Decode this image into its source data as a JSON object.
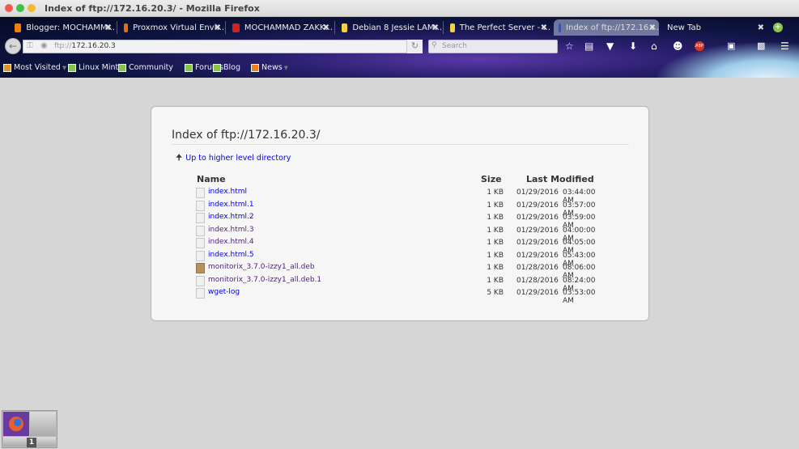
{
  "window": {
    "title": "Index of ftp://172.16.20.3/ - Mozilla Firefox"
  },
  "tabs": [
    {
      "label": "Blogger: MOCHAMM...",
      "icon": "blogger-icon",
      "color": "#f57d00"
    },
    {
      "label": "Proxmox Virtual Envi...",
      "icon": "proxmox-icon",
      "color": "#e57000"
    },
    {
      "label": "MOCHAMMAD ZAKK...",
      "icon": "zotero-icon",
      "color": "#cc2222"
    },
    {
      "label": "Debian 8 Jessie LAM...",
      "icon": "lightbulb-icon",
      "color": "#f5d142"
    },
    {
      "label": "The Perfect Server - ...",
      "icon": "lightbulb-icon",
      "color": "#f5d142"
    },
    {
      "label": "Index of ftp://172.16....",
      "icon": "monitor-icon",
      "color": "#3355aa"
    },
    {
      "label": "New Tab",
      "icon": "",
      "color": ""
    }
  ],
  "nav": {
    "url_prefix": "ftp://",
    "url_host": "172.16.20.3",
    "search_placeholder": "Search"
  },
  "bookmarks": [
    "Most Visited",
    "Linux Mint",
    "Community",
    "Forums",
    "Blog",
    "News"
  ],
  "page": {
    "heading": "Index of ftp://172.16.20.3/",
    "up_link": "Up to higher level directory",
    "columns": {
      "name": "Name",
      "size": "Size",
      "modified": "Last Modified"
    },
    "files": [
      {
        "name": "index.html",
        "size": "1 KB",
        "date": "01/29/2016",
        "time": "03:44:00 AM",
        "visited": false,
        "type": "html"
      },
      {
        "name": "index.html.1",
        "size": "1 KB",
        "date": "01/29/2016",
        "time": "03:57:00 AM",
        "visited": false,
        "type": "file"
      },
      {
        "name": "index.html.2",
        "size": "1 KB",
        "date": "01/29/2016",
        "time": "03:59:00 AM",
        "visited": false,
        "type": "file"
      },
      {
        "name": "index.html.3",
        "size": "1 KB",
        "date": "01/29/2016",
        "time": "04:00:00 AM",
        "visited": true,
        "type": "file"
      },
      {
        "name": "index.html.4",
        "size": "1 KB",
        "date": "01/29/2016",
        "time": "04:05:00 AM",
        "visited": true,
        "type": "file"
      },
      {
        "name": "index.html.5",
        "size": "1 KB",
        "date": "01/29/2016",
        "time": "05:43:00 AM",
        "visited": false,
        "type": "file"
      },
      {
        "name": "monitorix_3.7.0-izzy1_all.deb",
        "size": "1 KB",
        "date": "01/28/2016",
        "time": "08:06:00 AM",
        "visited": true,
        "type": "package"
      },
      {
        "name": "monitorix_3.7.0-izzy1_all.deb.1",
        "size": "1 KB",
        "date": "01/28/2016",
        "time": "08:24:00 AM",
        "visited": true,
        "type": "file"
      },
      {
        "name": "wget-log",
        "size": "5 KB",
        "date": "01/29/2016",
        "time": "03:53:00 AM",
        "visited": false,
        "type": "file"
      }
    ]
  },
  "workspace": {
    "current": "1"
  },
  "colors": {
    "link": "#0000ee",
    "visited": "#551a8b"
  }
}
